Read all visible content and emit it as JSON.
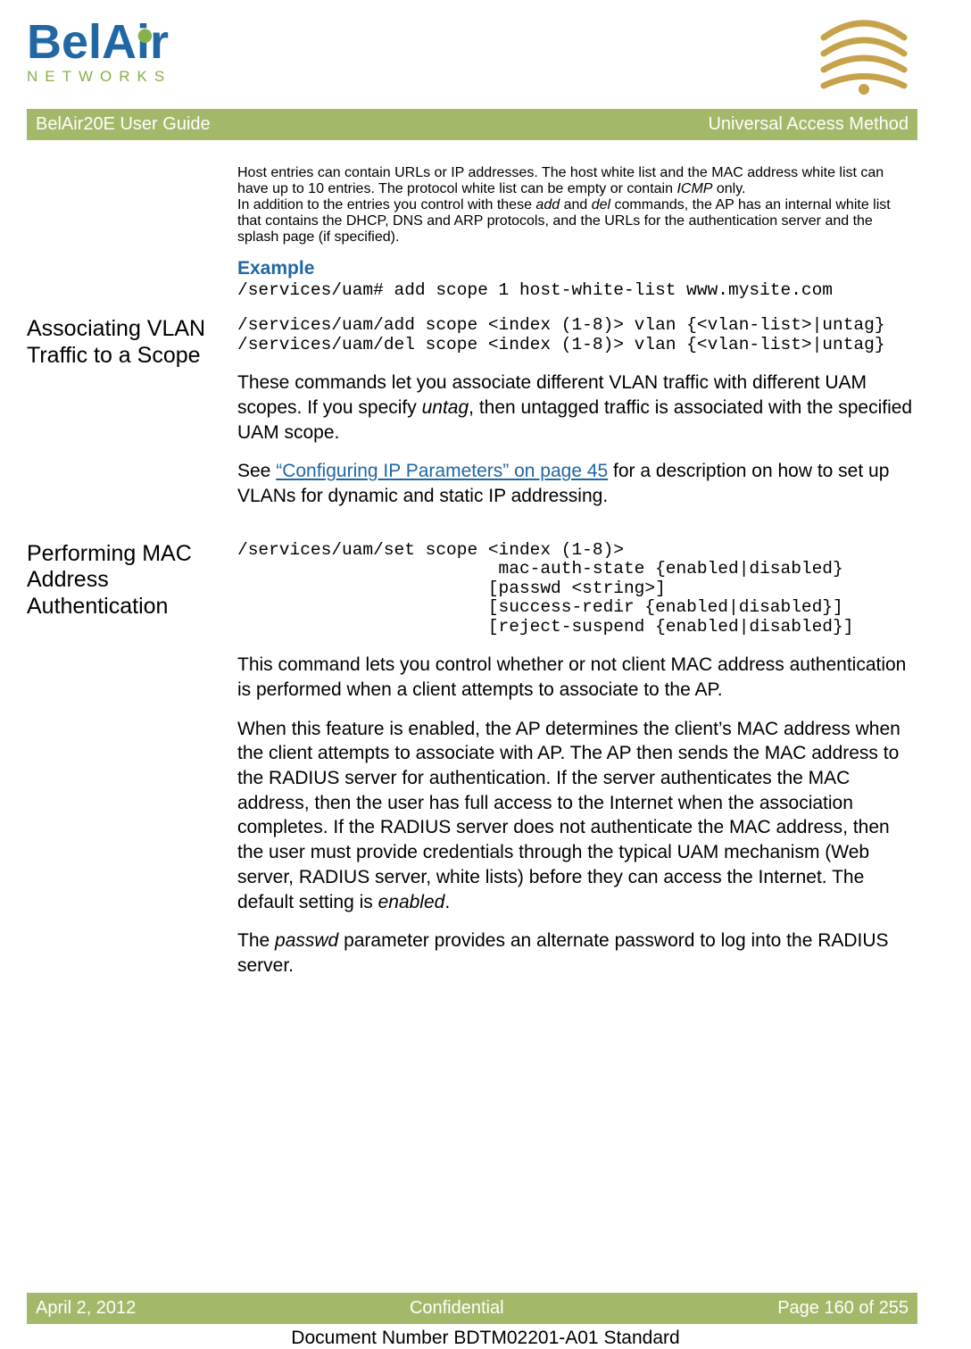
{
  "header": {
    "brand": "BelAir",
    "subbrand": "NETWORKS",
    "banner_left": "BelAir20E User Guide",
    "banner_right": "Universal Access Method"
  },
  "body": {
    "intro_p1_a": "Host entries can contain URLs or IP addresses. The host white list and the MAC address white list can have up to 10 entries. The protocol white list can be empty or contain ",
    "intro_p1_italic": "ICMP",
    "intro_p1_b": " only.",
    "intro_p2_a": "In addition to the entries you control with these ",
    "intro_p2_i1": "add",
    "intro_p2_b": " and ",
    "intro_p2_i2": "del",
    "intro_p2_c": " commands, the AP has an internal white list that contains the DHCP, DNS and ARP protocols, and the URLs for the authentication server and the splash page (if specified).",
    "example_label": "Example",
    "example_code": "/services/uam# add scope 1 host-white-list www.mysite.com",
    "sec1_heading": "Associating VLAN Traffic to a Scope",
    "sec1_code": "/services/uam/add scope <index (1-8)> vlan {<vlan-list>|untag}\n/services/uam/del scope <index (1-8)> vlan {<vlan-list>|untag}",
    "sec1_p1_a": "These commands let you associate different VLAN traffic with different UAM scopes. If you specify ",
    "sec1_p1_i": "untag",
    "sec1_p1_b": ", then untagged traffic is associated with the specified UAM scope.",
    "sec1_p2_a": "See ",
    "sec1_link": "“Configuring IP Parameters” on page 45",
    "sec1_p2_b": " for a description on how to set up VLANs for dynamic and static IP addressing.",
    "sec2_heading": "Performing MAC Address Authentication",
    "sec2_code": "/services/uam/set scope <index (1-8)>\n                         mac-auth-state {enabled|disabled}\n                        [passwd <string>]\n                        [success-redir {enabled|disabled}]\n                        [reject-suspend {enabled|disabled}]",
    "sec2_p1": "This command lets you control whether or not client MAC address authentication is performed when a client attempts to associate to the AP.",
    "sec2_p2_a": "When this feature is enabled, the AP determines the client’s MAC address when the client attempts to associate with AP. The AP then sends the MAC address to the RADIUS server for authentication. If the server authenticates the MAC address, then the user has full access to the Internet when the association completes. If the RADIUS server does not authenticate the MAC address, then the user must provide credentials through the typical UAM mechanism (Web server, RADIUS server, white lists) before they can access the Internet. The default setting is ",
    "sec2_p2_i": "enabled",
    "sec2_p2_b": ".",
    "sec2_p3_a": "The ",
    "sec2_p3_i": "passwd",
    "sec2_p3_b": " parameter provides an alternate password to log into the RADIUS server."
  },
  "footer": {
    "left": "April 2, 2012",
    "center": "Confidential",
    "right": "Page 160 of 255",
    "docnum": "Document Number BDTM02201-A01 Standard"
  }
}
